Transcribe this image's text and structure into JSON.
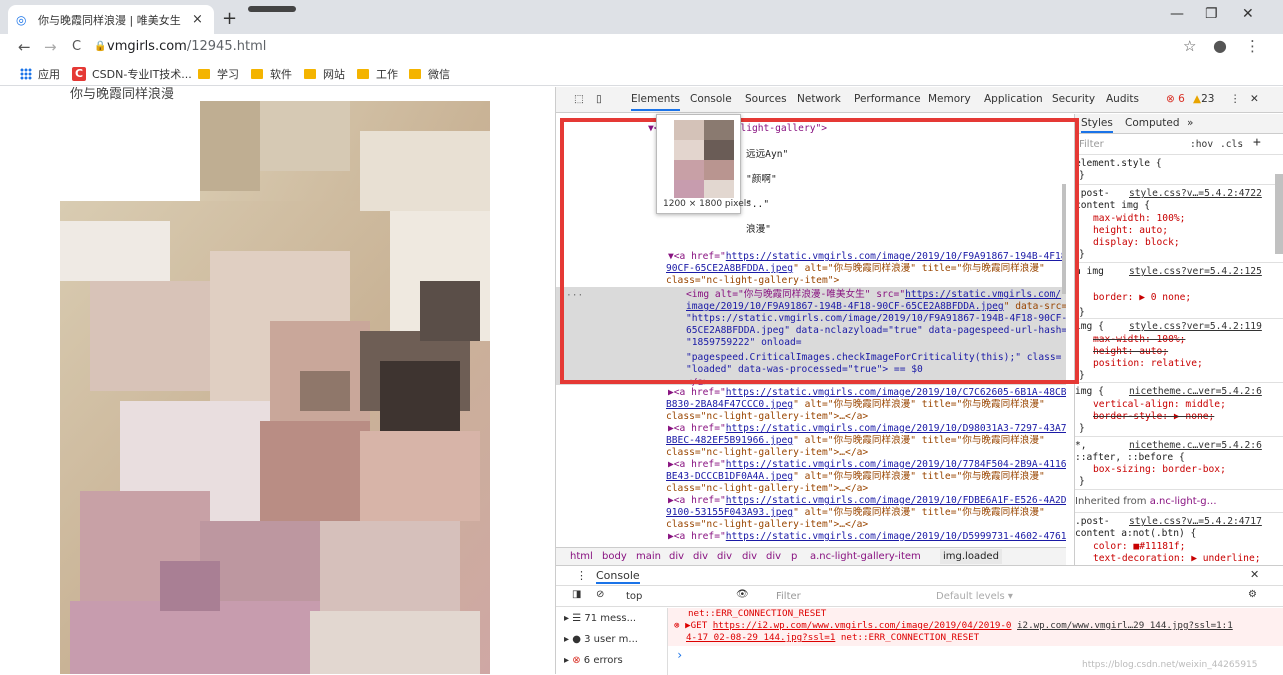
{
  "browser": {
    "tab_title": "你与晚霞同样浪漫 | 唯美女生",
    "tab_close": "×",
    "new_tab": "+",
    "url_host": "vmgirls.com",
    "url_path": "/12945.html",
    "window_controls": {
      "minimize": "—",
      "restore": "❐",
      "close": "✕"
    },
    "nav": {
      "back": "←",
      "forward": "→",
      "reload": "C"
    }
  },
  "bookmarks": [
    {
      "label": "应用",
      "icon": "apps-icon"
    },
    {
      "label": "CSDN-专业IT技术...",
      "icon": "csdn-icon"
    },
    {
      "label": "学习",
      "icon": "folder-icon"
    },
    {
      "label": "软件",
      "icon": "folder-icon"
    },
    {
      "label": "网站",
      "icon": "folder-icon"
    },
    {
      "label": "工作",
      "icon": "folder-icon"
    },
    {
      "label": "微信",
      "icon": "folder-icon"
    }
  ],
  "page": {
    "title": "你与晚霞同样浪漫"
  },
  "devtools": {
    "tabs": [
      "Elements",
      "Console",
      "Sources",
      "Network",
      "Performance",
      "Memory",
      "Application",
      "Security",
      "Audits"
    ],
    "error_count": "6",
    "warning_count": "23",
    "tooltip_caption": "1200 × 1800 pixels",
    "elements": {
      "line1": "▼<div class=\"nc-light-gallery\">",
      "t1": "远远Ayn\"",
      "t2": "\"颜啊\"",
      "t3": "\"..\"",
      "t4": "浪漫\"",
      "a_open": "▼<a href=\"",
      "a_href1": "https://static.vmgirls.com/image/2019/10/F9A91867-194B-4F18-",
      "a_href2": "90CF-65CE2A8BFDDA.jpeg",
      "a_rest": "\" alt=\"你与晚霞同样浪漫\" title=\"你与晚霞同样浪漫\"",
      "a_class": "class=\"nc-light-gallery-item\">",
      "img1": "<img alt=\"你与晚霞同样浪漫-唯美女生\" src=\"",
      "img_src1": "https://static.vmgirls.com/",
      "img_src2": "image/2019/10/F9A91867-194B-4F18-90CF-65CE2A8BFDDA.jpeg",
      "img2b": "\" data-src=",
      "img3": "\"https://static.vmgirls.com/image/2019/10/F9A91867-194B-4F18-90CF-",
      "img4": "65CE2A8BFDDA.jpeg\" data-nclazyload=\"true\" data-pagespeed-url-hash=",
      "img5": "\"1859759222\" onload=",
      "img6": "\"pagespeed.CriticalImages.checkImageForCriticality(this);\" class=",
      "img7": "\"loaded\" data-was-processed=\"true\"> == $0",
      "a_close": "</a>",
      "more_links": [
        {
          "h1": "https://static.vmgirls.com/image/2019/10/C7C62605-6B1A-48CB-",
          "h2": "B830-2BA84F47CCC0.jpeg"
        },
        {
          "h1": "https://static.vmgirls.com/image/2019/10/D98031A3-7297-43A7-",
          "h2": "BBEC-482EF5B91966.jpeg"
        },
        {
          "h1": "https://static.vmgirls.com/image/2019/10/7784F504-2B9A-4116-",
          "h2": "BE43-DCCCB1DF0A4A.jpeg"
        },
        {
          "h1": "https://static.vmgirls.com/image/2019/10/FDBE6A1F-E526-4A2D-",
          "h2": "9100-53155F043A93.jpeg"
        },
        {
          "h1": "https://static.vmgirls.com/image/2019/10/D5999731-4602-4761-",
          "h2": ""
        }
      ],
      "more_rest": "\" alt=\"你与晚霞同样浪漫\" title=\"你与晚霞同样浪漫\"",
      "more_class": "class=\"nc-light-gallery-item\">…</a>"
    },
    "breadcrumbs": [
      "html",
      "body",
      "main",
      "div",
      "div",
      "div",
      "div",
      "div",
      "p",
      "a.nc-light-gallery-item",
      "img.loaded"
    ],
    "styles": {
      "tabs": [
        "Styles",
        "Computed",
        "»"
      ],
      "filter_placeholder": "Filter",
      "hov": ":hov",
      "cls": ".cls",
      "rules": [
        {
          "selector": "element.style {",
          "source": ""
        },
        {
          "selector": ".post-content img {",
          "source": "style.css?v…=5.4.2:4722"
        },
        {
          "selector": "a img",
          "source": "style.css?ver=5.4.2:125"
        },
        {
          "selector": "img {",
          "source": "style.css?ver=5.4.2:119"
        },
        {
          "selector": "img {",
          "source": "nicetheme.c…ver=5.4.2:6"
        },
        {
          "selector": "*, ::after, ::before {",
          "source": "nicetheme.c…ver=5.4.2:6"
        }
      ],
      "decls": {
        "max_width": "max-width: 100%;",
        "height_auto": "height: auto;",
        "display_block": "display: block;",
        "border": "border: ▶ 0 none;",
        "max_width_strike": "max-width: 100%;",
        "height_auto_strike": "height: auto;",
        "position": "position: relative;",
        "vertical_align": "vertical-align: middle;",
        "border_style": "border-style: ▶ none;",
        "box_sizing": "box-sizing: border-box;",
        "color": "color: ■#11181f;",
        "text_decoration": "text-decoration: ▶ underline;"
      },
      "inherited_label": "Inherited from",
      "inherited_from": "a.nc-light-g…",
      "inherited_rule": ".post-content a:not(.btn) {",
      "inherited_source": "style.css?v…=5.4.2:4717"
    },
    "console": {
      "title": "Console",
      "context": "top",
      "filter_placeholder": "Filter",
      "levels": "Default levels ▾",
      "sidebar": [
        {
          "icon": "list-icon",
          "label": "71 mess..."
        },
        {
          "icon": "user-icon",
          "label": "3 user m..."
        },
        {
          "icon": "error-icon",
          "label": "6 errors"
        }
      ],
      "log1": "net::ERR_CONNECTION_RESET",
      "log2_prefix": "▶GET ",
      "log2_url": "https://i2.wp.com/www.vmgirls.com/image/2019/04/2019-0",
      "log2_src": "i2.wp.com/www.vmgirl…29_144.jpg?ssl=1:1",
      "log3_url": "4-17_02-08-29_144.jpg?ssl=1",
      "log3_rest": " net::ERR_CONNECTION_RESET",
      "prompt": "›"
    }
  },
  "watermark": "https://blog.csdn.net/weixin_44265915"
}
